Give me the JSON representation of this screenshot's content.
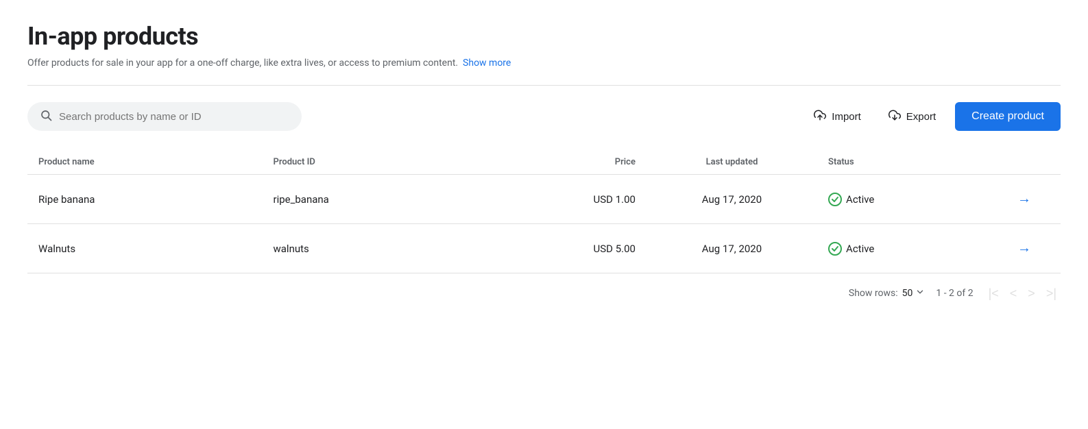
{
  "page": {
    "title": "In-app products",
    "subtitle": "Offer products for sale in your app for a one-off charge, like extra lives, or access to premium content.",
    "show_more_link": "Show more"
  },
  "toolbar": {
    "search_placeholder": "Search products by name or ID",
    "import_label": "Import",
    "export_label": "Export",
    "create_label": "Create product"
  },
  "table": {
    "columns": [
      {
        "key": "name",
        "label": "Product name"
      },
      {
        "key": "id",
        "label": "Product ID"
      },
      {
        "key": "price",
        "label": "Price"
      },
      {
        "key": "updated",
        "label": "Last updated"
      },
      {
        "key": "status",
        "label": "Status"
      }
    ],
    "rows": [
      {
        "name": "Ripe banana",
        "id": "ripe_banana",
        "price": "USD 1.00",
        "updated": "Aug 17, 2020",
        "status": "Active"
      },
      {
        "name": "Walnuts",
        "id": "walnuts",
        "price": "USD 5.00",
        "updated": "Aug 17, 2020",
        "status": "Active"
      }
    ]
  },
  "footer": {
    "show_rows_label": "Show rows:",
    "rows_value": "50",
    "pagination_info": "1 - 2 of 2"
  }
}
